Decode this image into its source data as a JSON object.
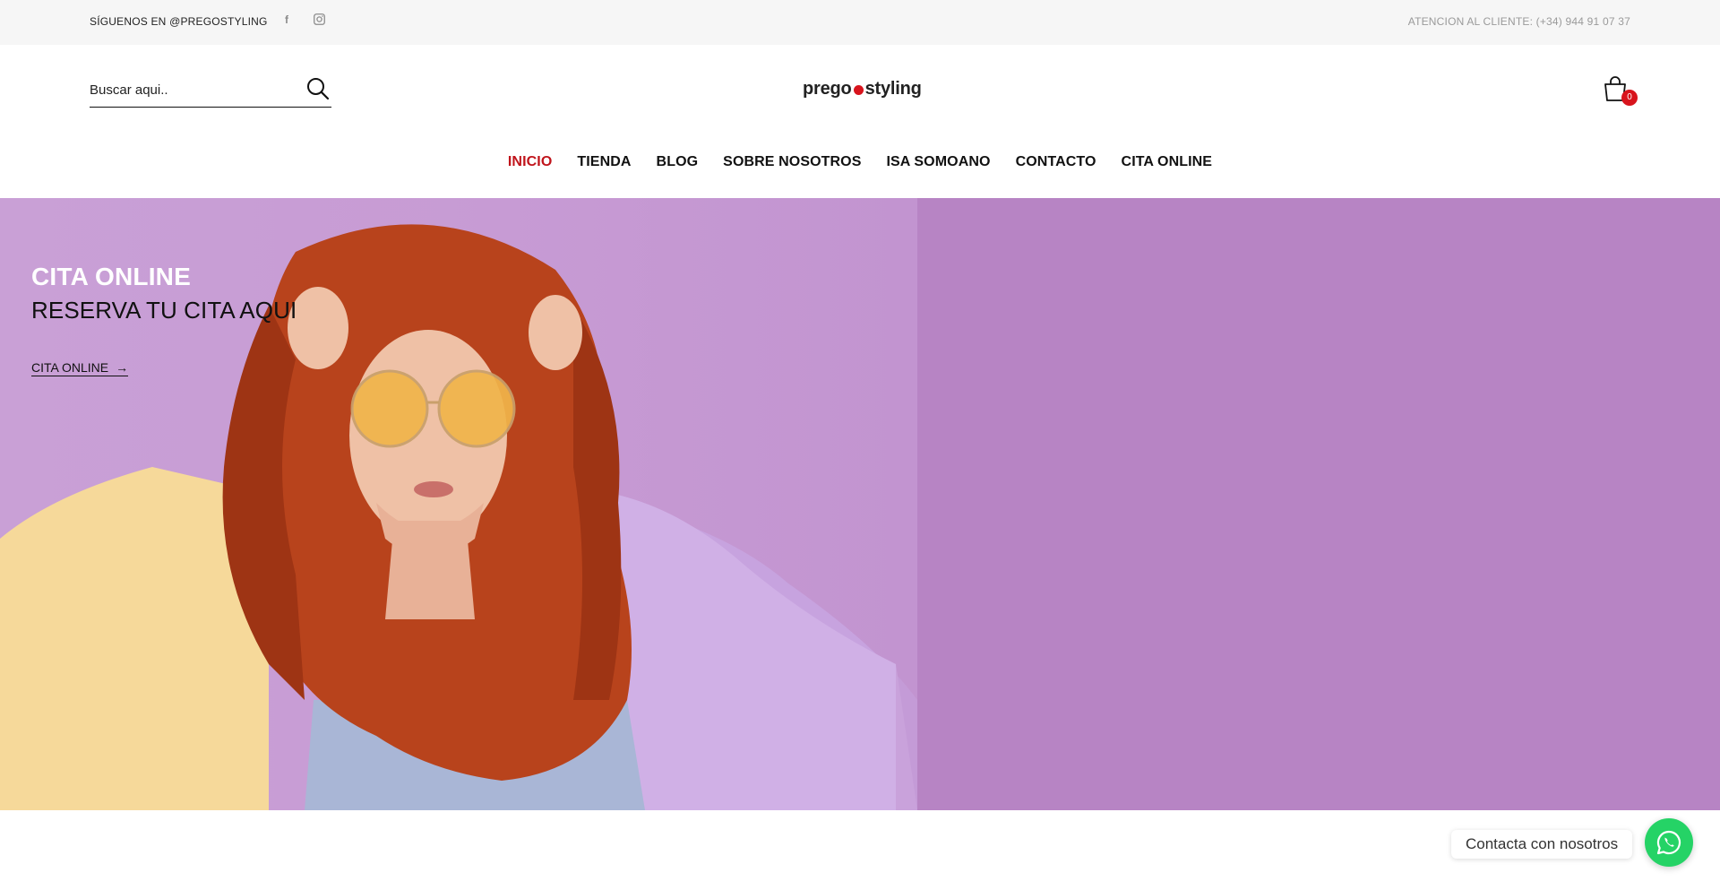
{
  "topbar": {
    "follow_text": "SÍGUENOS EN @PREGOSTYLING",
    "social_icons": [
      "facebook-icon",
      "instagram-icon"
    ],
    "support_text": "ATENCION AL CLIENTE: (+34) 944 91 07 37"
  },
  "header": {
    "search": {
      "placeholder": "Buscar aqui..",
      "value": ""
    },
    "logo": {
      "left": "prego",
      "right": "styling"
    },
    "cart": {
      "count": "0"
    }
  },
  "nav": {
    "items": [
      {
        "label": "INICIO",
        "active": true
      },
      {
        "label": "TIENDA"
      },
      {
        "label": "BLOG"
      },
      {
        "label": "SOBRE NOSOTROS"
      },
      {
        "label": "ISA SOMOANO"
      },
      {
        "label": "CONTACTO"
      },
      {
        "label": "CITA ONLINE"
      }
    ]
  },
  "hero": {
    "title": "CITA ONLINE",
    "subtitle": "RESERVA TU CITA AQUI",
    "cta": "CITA ONLINE",
    "background_color": "#b784c4"
  },
  "whatsapp": {
    "label": "Contacta con nosotros",
    "color": "#25d366"
  },
  "colors": {
    "accent": "#c0141b",
    "badge": "#d8141d"
  }
}
